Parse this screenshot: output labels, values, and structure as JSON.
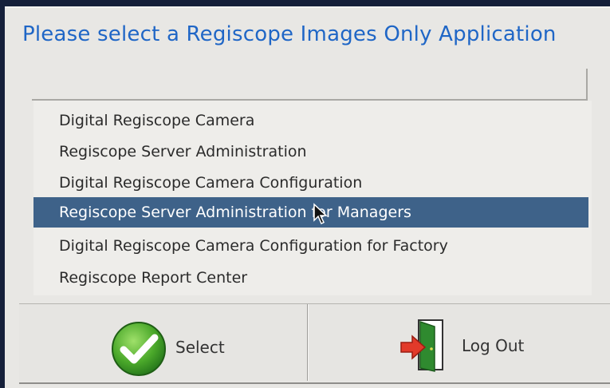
{
  "dialog": {
    "title": "Please select a Regiscope Images Only Application"
  },
  "applications": [
    {
      "label": "Digital Regiscope Camera",
      "selected": false
    },
    {
      "label": "Regiscope Server Administration",
      "selected": false
    },
    {
      "label": "Digital Regiscope Camera Configuration",
      "selected": false
    },
    {
      "label": "Regiscope Server Administration for Managers",
      "selected": true
    },
    {
      "label": "Digital Regiscope Camera Configuration for Factory",
      "selected": false
    },
    {
      "label": "Regiscope Report Center",
      "selected": false
    }
  ],
  "buttons": {
    "select_label": "Select",
    "select_icon": "green-checkmark-icon",
    "logout_label": "Log Out",
    "logout_icon": "exit-door-icon"
  },
  "colors": {
    "title": "#1f66c6",
    "selection": "#3e6289",
    "background": "#e8e7e4"
  }
}
